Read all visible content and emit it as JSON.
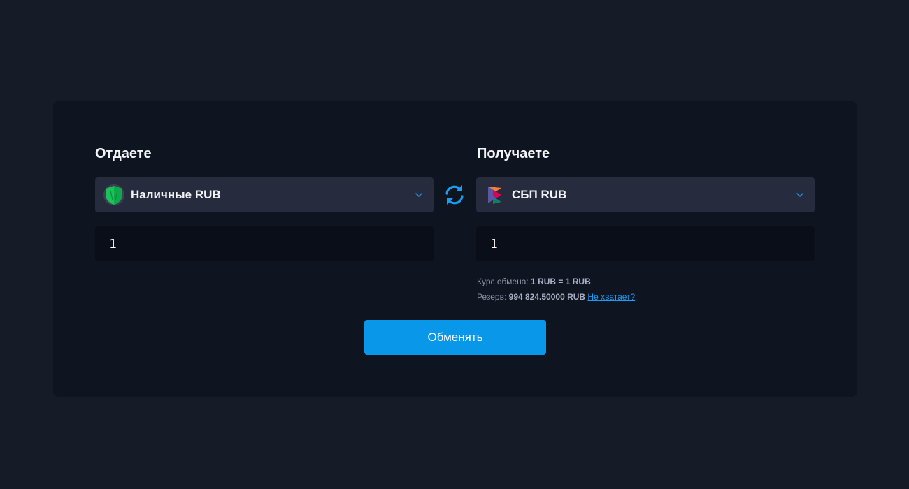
{
  "give": {
    "title": "Отдаете",
    "currency": "Наличные RUB",
    "currency_icon": "cash-shield-icon",
    "amount": "1"
  },
  "receive": {
    "title": "Получаете",
    "currency": "СБП RUB",
    "currency_icon": "sbp-logo-icon",
    "amount": "1"
  },
  "rate": {
    "label": "Курс обмена:",
    "value": "1 RUB = 1 RUB"
  },
  "reserve": {
    "label": "Резерв:",
    "value": "994 824.50000 RUB",
    "link": "Не хватает?"
  },
  "submit_label": "Обменять",
  "colors": {
    "background": "#161b28",
    "card": "#0f1421",
    "select": "#262b3d",
    "input": "#0a0e18",
    "accent": "#0997ea",
    "link": "#1a9cf0"
  }
}
